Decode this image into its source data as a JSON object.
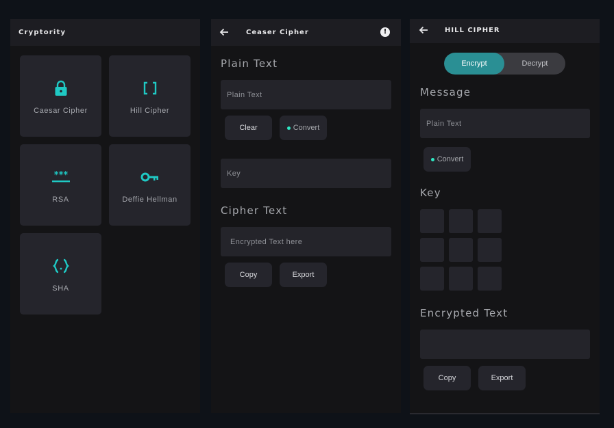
{
  "colors": {
    "accent": "#1fc9c4",
    "toggle_active": "#2a8f94",
    "background": "#0e1218",
    "panel": "#141416",
    "card": "#25252c"
  },
  "home": {
    "title": "Cryptority",
    "tiles": [
      {
        "label": "Caesar Cipher",
        "icon": "lock-icon"
      },
      {
        "label": "Hill Cipher",
        "icon": "brackets-icon"
      },
      {
        "label": "RSA",
        "icon": "password-icon"
      },
      {
        "label": "Deffie Hellman",
        "icon": "key-icon"
      },
      {
        "label": "SHA",
        "icon": "braces-icon"
      }
    ]
  },
  "caesar": {
    "title": "Ceaser Cipher",
    "plain_heading": "Plain Text",
    "plain_placeholder": "Plain Text",
    "clear_label": "Clear",
    "convert_label": "Convert",
    "key_placeholder": "Key",
    "cipher_heading": "Cipher Text",
    "cipher_placeholder": "Encrypted Text here",
    "copy_label": "Copy",
    "export_label": "Export"
  },
  "hill": {
    "title": "HILL CIPHER",
    "encrypt_label": "Encrypt",
    "decrypt_label": "Decrypt",
    "message_heading": "Message",
    "message_placeholder": "Plain Text",
    "convert_label": "Convert",
    "key_heading": "Key",
    "encrypted_heading": "Encrypted Text",
    "copy_label": "Copy",
    "export_label": "Export"
  }
}
